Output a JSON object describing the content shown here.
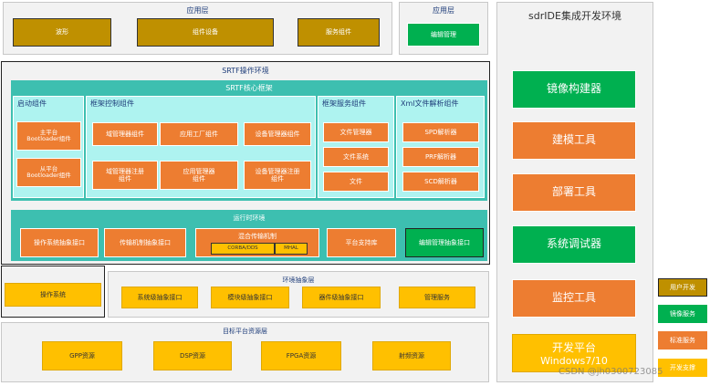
{
  "app_layer_1": {
    "title": "应用层",
    "items": [
      "波形",
      "组件设备",
      "服务组件"
    ]
  },
  "app_layer_2": {
    "title": "应用层",
    "item": "编辑管理"
  },
  "srtf": {
    "title": "SRTF操作环境",
    "core": {
      "title": "SRTF核心框架",
      "boot": {
        "title": "启动组件",
        "items": [
          "主平台\nBootloader组件",
          "从平台\nBootloader组件"
        ]
      },
      "control": {
        "title": "框架控制组件",
        "items": [
          "域管理器组件",
          "应用工厂组件",
          "设备管理器组件",
          "域管理器注册\n组件",
          "应用管理器\n组件",
          "设备管理器注册\n组件"
        ]
      },
      "service": {
        "title": "框架服务组件",
        "items": [
          "文件管理器",
          "文件系统",
          "文件"
        ]
      },
      "xml": {
        "title": "Xml文件解析组件",
        "items": [
          "SPD解析器",
          "PRF解析器",
          "SCD解析器"
        ]
      }
    },
    "runtime": {
      "title": "运行时环境",
      "items": [
        "操作系统抽象接口",
        "传输机制抽象接口",
        "平台支持库",
        "编辑管理抽象接口"
      ],
      "mixed": {
        "label": "混合传输机制",
        "parts": [
          "CORBA/DDS",
          "MHAL"
        ]
      }
    }
  },
  "os": {
    "label": "操作系统"
  },
  "env_layer": {
    "title": "环境抽象层",
    "items": [
      "系统级抽象接口",
      "模块级抽象接口",
      "器件级抽象接口",
      "管理服务"
    ]
  },
  "target": {
    "title": "目标平台资源层",
    "items": [
      "GPP资源",
      "DSP资源",
      "FPGA资源",
      "射频资源"
    ]
  },
  "ide": {
    "title": "sdrIDE集成开发环境",
    "items": [
      "镜像构建器",
      "建模工具",
      "部署工具",
      "系统调试器",
      "监控工具"
    ],
    "platform": {
      "line1": "开发平台",
      "line2": "Windows7/10"
    }
  },
  "legend": [
    "用户开发",
    "镜像服务",
    "标准服务",
    "开发支撑"
  ],
  "watermark": "CSDN @jh0300723085",
  "colors": {
    "gold": "#bf9000",
    "yellow": "#ffc000",
    "orange": "#ed7d31",
    "green": "#00b050",
    "teal": "#3dbfb0"
  }
}
